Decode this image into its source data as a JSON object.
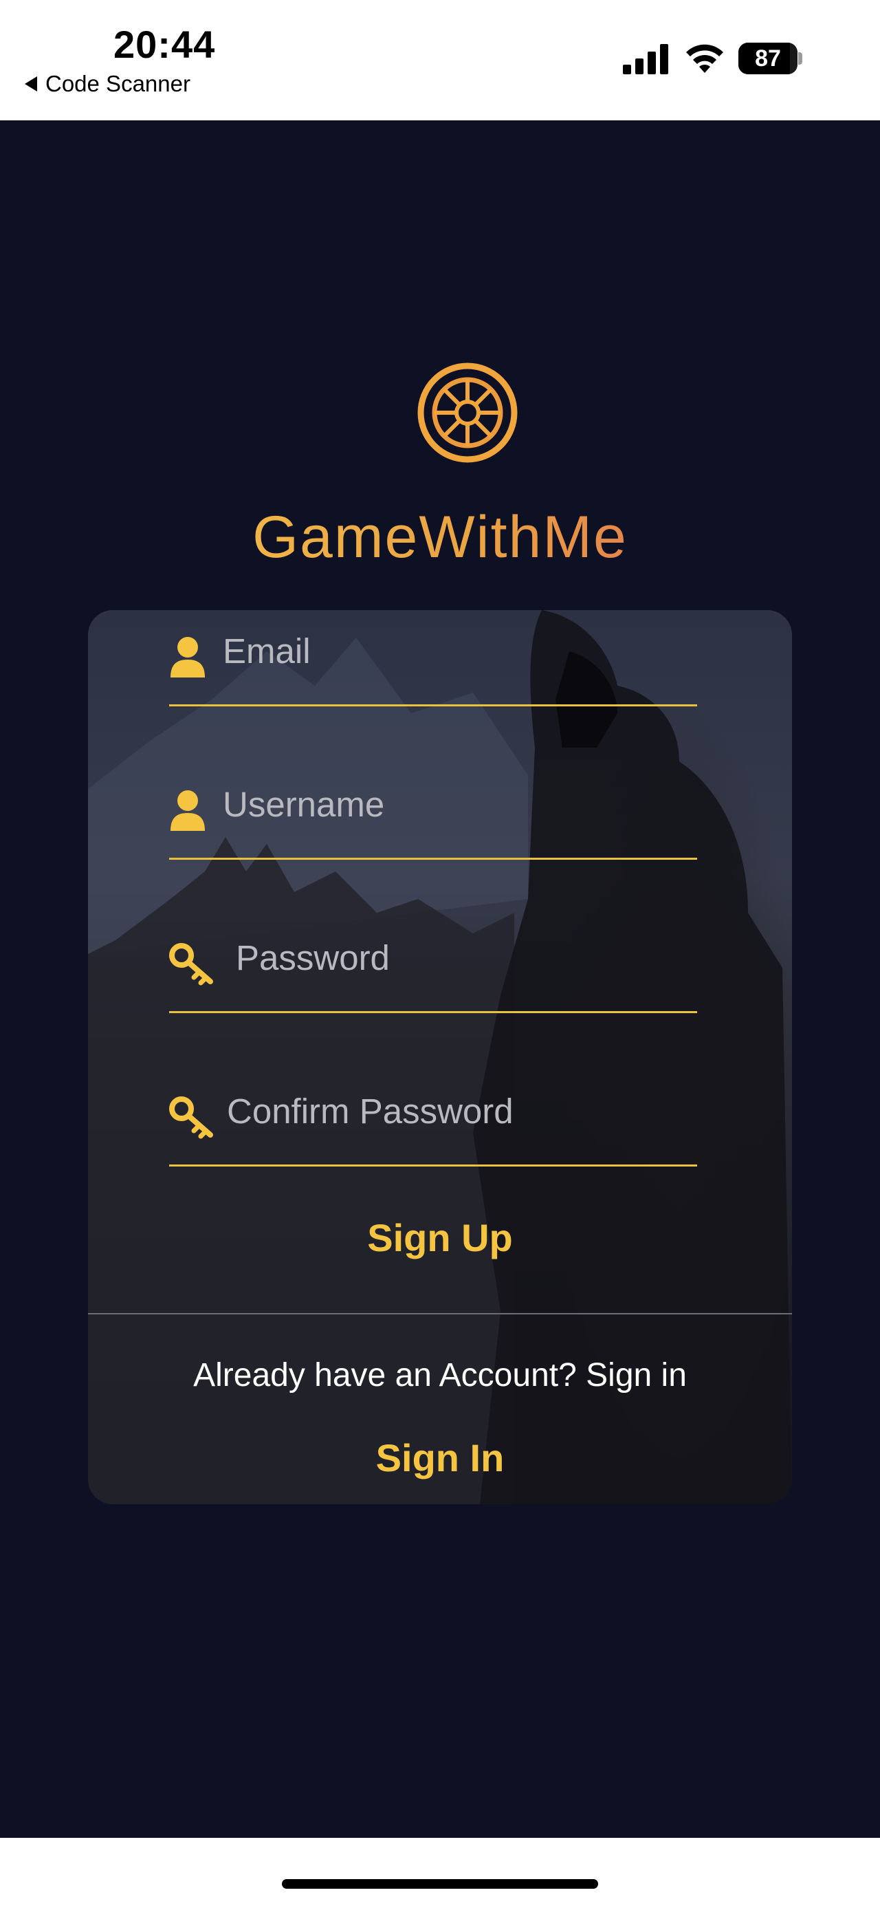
{
  "status_bar": {
    "time": "20:44",
    "back_label": "Code Scanner",
    "battery_percent": "87",
    "signal_icon": "signal-bars-icon",
    "wifi_icon": "wifi-icon"
  },
  "app": {
    "brand_name": "GameWithMe",
    "logo_icon": "speeding-wheel-icon",
    "colors": {
      "background": "#0e1024",
      "accent": "#f5c542",
      "field_line": "#e9c13f"
    }
  },
  "form": {
    "email_placeholder": "Email",
    "username_placeholder": "Username",
    "password_placeholder": "Password",
    "confirm_password_placeholder": "Confirm Password",
    "sign_up_label": "Sign Up",
    "prompt_text": "Already have an Account? Sign in",
    "sign_in_label": "Sign In",
    "icons": {
      "email": "user-icon",
      "username": "user-icon",
      "password": "key-icon",
      "confirm_password": "key-icon"
    }
  }
}
